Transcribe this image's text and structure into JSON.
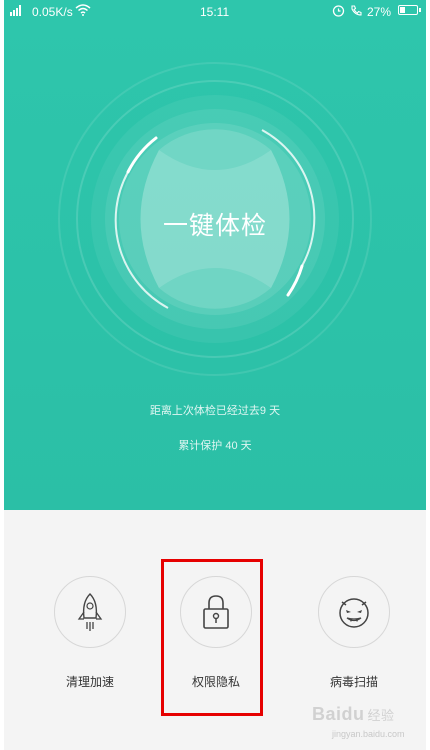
{
  "status_bar": {
    "network_speed": "0.05K/s",
    "time": "15:11",
    "battery_percent": "27%",
    "icons": [
      "signal-icon",
      "wifi-icon",
      "alarm-icon",
      "call-icon",
      "battery-icon"
    ]
  },
  "hero": {
    "check_button_label": "一键体检",
    "last_check_text": "距离上次体检已经过去9 天",
    "protection_text": "累计保护 40 天",
    "accent_color": "#2ec6ac"
  },
  "tools": [
    {
      "label": "清理加速",
      "icon": "rocket-icon"
    },
    {
      "label": "权限隐私",
      "icon": "lock-icon"
    },
    {
      "label": "病毒扫描",
      "icon": "devil-face-icon"
    }
  ],
  "annotation": {
    "highlight_color": "#e60000"
  },
  "watermark": {
    "brand": "Baidu",
    "suffix": "经验",
    "url": "jingyan.baidu.com"
  }
}
